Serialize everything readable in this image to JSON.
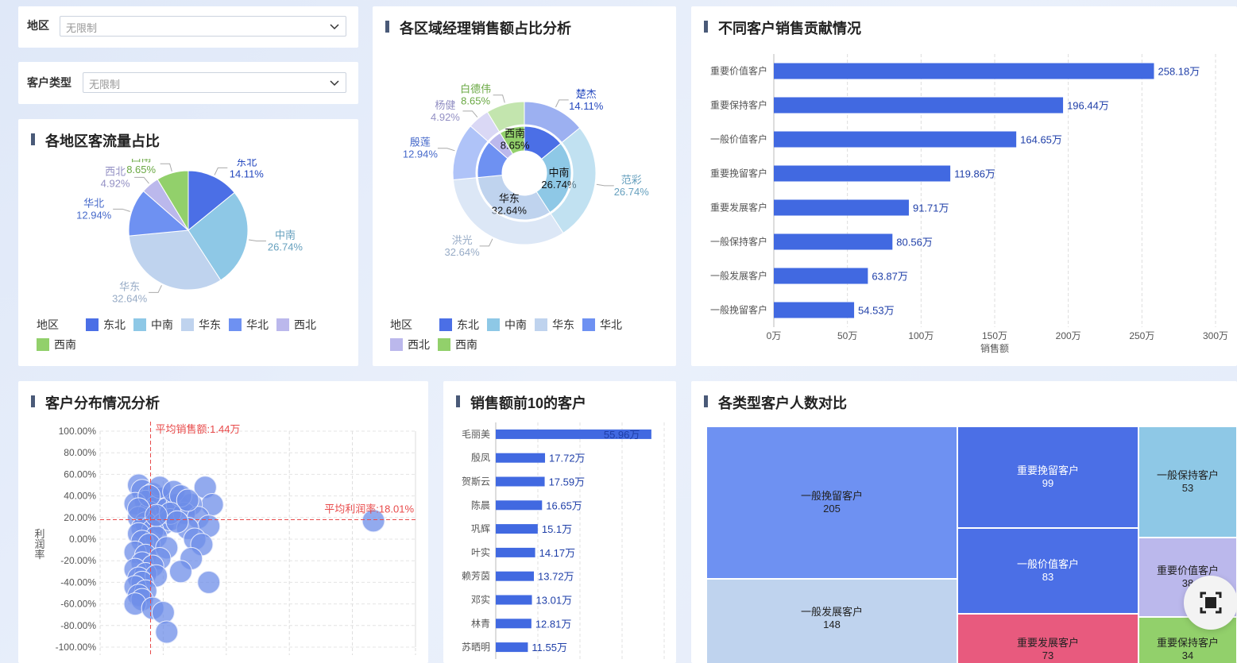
{
  "filters": {
    "region": {
      "label": "地区",
      "value": "无限制"
    },
    "customer_type": {
      "label": "客户类型",
      "value": "无限制"
    }
  },
  "colors": {
    "东北": "#4b6fe6",
    "中南": "#8ec8e6",
    "华东": "#bfd3ee",
    "华北": "#6e91f2",
    "西北": "#bbb8ec",
    "西南": "#92d06b",
    "bar": "#4169e1",
    "ref_line": "#e84a4a",
    "scatter": "#6d8de8",
    "重要发展客户": "#e85a7e",
    "重要保持客户": "#92d06b"
  },
  "region_pie": {
    "title": "各地区客流量占比",
    "legend_title": "地区",
    "legend": [
      "东北",
      "中南",
      "华东",
      "华北",
      "西北",
      "西南"
    ]
  },
  "manager_pie": {
    "title": "各区域经理销售额占比分析",
    "legend_title": "地区",
    "legend": [
      "东北",
      "中南",
      "华东",
      "华北",
      "西北",
      "西南"
    ]
  },
  "customer_bar": {
    "title": "不同客户销售贡献情况",
    "axis_label": "销售额"
  },
  "scatter": {
    "title": "客户分布情况分析",
    "ylabel": "利润率",
    "avg_sales_label": "平均销售额:1.44万",
    "avg_profit_label": "平均利润率:18.01%"
  },
  "top10": {
    "title": "销售额前10的客户"
  },
  "treemap": {
    "title": "各类型客户人数对比",
    "cells": [
      {
        "name": "一般挽留客户",
        "value": "205"
      },
      {
        "name": "一般发展客户",
        "value": "148"
      },
      {
        "name": "重要挽留客户",
        "value": "99"
      },
      {
        "name": "一般价值客户",
        "value": "83"
      },
      {
        "name": "重要发展客户",
        "value": "73"
      },
      {
        "name": "一般保持客户",
        "value": "53"
      },
      {
        "name": "重要价值客户",
        "value": "38"
      },
      {
        "name": "重要保持客户",
        "value": "34"
      }
    ]
  },
  "chart_data": [
    {
      "type": "pie",
      "title": "各地区客流量占比",
      "slices": [
        {
          "label": "东北",
          "value": 14.11,
          "text": "14.11%"
        },
        {
          "label": "中南",
          "value": 26.74,
          "text": "26.74%"
        },
        {
          "label": "华东",
          "value": 32.64,
          "text": "32.64%"
        },
        {
          "label": "华北",
          "value": 12.94,
          "text": "12.94%"
        },
        {
          "label": "西北",
          "value": 4.92,
          "text": "4.92%"
        },
        {
          "label": "西南",
          "value": 8.65,
          "text": "8.65%"
        }
      ]
    },
    {
      "type": "pie",
      "title": "各区域经理销售额占比分析",
      "inner": [
        {
          "label": "东北",
          "value": 14.11
        },
        {
          "label": "中南",
          "value": 26.74,
          "text": "26.74%"
        },
        {
          "label": "华东",
          "value": 32.64,
          "text": "32.64%"
        },
        {
          "label": "华北",
          "value": 12.94
        },
        {
          "label": "西北",
          "value": 4.92
        },
        {
          "label": "西南",
          "value": 8.65,
          "text": "8.65%"
        }
      ],
      "outer": [
        {
          "label": "楚杰",
          "region": "东北",
          "value": 14.11,
          "text": "14.11%"
        },
        {
          "label": "范彩",
          "region": "中南",
          "value": 26.74,
          "text": "26.74%"
        },
        {
          "label": "洪光",
          "region": "华东",
          "value": 32.64,
          "text": "32.64%"
        },
        {
          "label": "殷莲",
          "region": "华北",
          "value": 12.94,
          "text": "12.94%"
        },
        {
          "label": "杨健",
          "region": "西北",
          "value": 4.92,
          "text": "4.92%"
        },
        {
          "label": "白德伟",
          "region": "西南",
          "value": 8.65,
          "text": "8.65%"
        }
      ]
    },
    {
      "type": "bar",
      "title": "不同客户销售贡献情况",
      "orientation": "horizontal",
      "categories": [
        "重要价值客户",
        "重要保持客户",
        "一般价值客户",
        "重要挽留客户",
        "重要发展客户",
        "一般保持客户",
        "一般发展客户",
        "一般挽留客户"
      ],
      "values": [
        258.18,
        196.44,
        164.65,
        119.86,
        91.71,
        80.56,
        63.87,
        54.53
      ],
      "value_labels": [
        "258.18万",
        "196.44万",
        "164.65万",
        "119.86万",
        "91.71万",
        "80.56万",
        "63.87万",
        "54.53万"
      ],
      "xlabel": "销售额",
      "xticks": [
        "0万",
        "50万",
        "100万",
        "150万",
        "200万",
        "250万",
        "300万"
      ],
      "xlim": [
        0,
        300
      ],
      "grid": true
    },
    {
      "type": "scatter",
      "title": "客户分布情况分析",
      "ylabel": "利润率",
      "yticks": [
        "100.00%",
        "80.00%",
        "60.00%",
        "40.00%",
        "20.00%",
        "0.00%",
        "-20.00%",
        "-40.00%",
        "-60.00%",
        "-80.00%",
        "-100.00%"
      ],
      "ylim": [
        -100,
        100
      ],
      "xlim": [
        0,
        9
      ],
      "avg_x": 1.44,
      "avg_y": 18.01,
      "points": [
        [
          1.1,
          50
        ],
        [
          1.2,
          45
        ],
        [
          1.5,
          42
        ],
        [
          1.7,
          38
        ],
        [
          1.3,
          35
        ],
        [
          1.0,
          33
        ],
        [
          1.6,
          30
        ],
        [
          1.9,
          28
        ],
        [
          2.2,
          32
        ],
        [
          1.4,
          25
        ],
        [
          1.1,
          20
        ],
        [
          1.3,
          15
        ],
        [
          1.8,
          14
        ],
        [
          2.0,
          18
        ],
        [
          1.2,
          10
        ],
        [
          1.5,
          8
        ],
        [
          1.1,
          5
        ],
        [
          1.6,
          2
        ],
        [
          1.2,
          -2
        ],
        [
          1.4,
          -5
        ],
        [
          1.9,
          -8
        ],
        [
          1.0,
          -12
        ],
        [
          1.3,
          -15
        ],
        [
          1.7,
          -18
        ],
        [
          1.2,
          -22
        ],
        [
          1.5,
          -25
        ],
        [
          1.0,
          -28
        ],
        [
          1.3,
          -32
        ],
        [
          1.1,
          -36
        ],
        [
          1.6,
          -34
        ],
        [
          1.2,
          -40
        ],
        [
          1.0,
          -44
        ],
        [
          1.3,
          -48
        ],
        [
          1.1,
          -52
        ],
        [
          1.2,
          -56
        ],
        [
          1.0,
          -60
        ],
        [
          1.5,
          -64
        ],
        [
          1.8,
          -68
        ],
        [
          1.9,
          -86
        ],
        [
          3.0,
          48
        ],
        [
          3.2,
          32
        ],
        [
          2.6,
          32
        ],
        [
          2.4,
          24
        ],
        [
          2.8,
          20
        ],
        [
          3.1,
          12
        ],
        [
          2.5,
          10
        ],
        [
          2.7,
          0
        ],
        [
          2.9,
          -5
        ],
        [
          2.6,
          -18
        ],
        [
          2.3,
          -30
        ],
        [
          3.1,
          -40
        ],
        [
          1.7,
          48
        ],
        [
          2.1,
          44
        ],
        [
          2.3,
          40
        ],
        [
          1.4,
          40
        ],
        [
          2.5,
          36
        ],
        [
          2.0,
          24
        ],
        [
          2.2,
          16
        ],
        [
          1.1,
          28
        ],
        [
          1.6,
          22
        ],
        [
          7.8,
          17
        ]
      ]
    },
    {
      "type": "bar",
      "title": "销售额前10的客户",
      "orientation": "horizontal",
      "categories": [
        "毛丽美",
        "殷凤",
        "贺斯云",
        "陈晨",
        "巩辉",
        "叶实",
        "赖芳茵",
        "邓实",
        "林青",
        "苏晒明"
      ],
      "values": [
        55.96,
        17.72,
        17.59,
        16.65,
        15.1,
        14.17,
        13.72,
        13.01,
        12.81,
        11.55
      ],
      "value_labels": [
        "55.96万",
        "17.72万",
        "17.59万",
        "16.65万",
        "15.1万",
        "14.17万",
        "13.72万",
        "13.01万",
        "12.81万",
        "11.55万"
      ],
      "xlim": [
        0,
        56
      ]
    },
    {
      "type": "treemap",
      "title": "各类型客户人数对比",
      "categories": [
        "一般挽留客户",
        "一般发展客户",
        "重要挽留客户",
        "一般价值客户",
        "重要发展客户",
        "一般保持客户",
        "重要价值客户",
        "重要保持客户"
      ],
      "values": [
        205,
        148,
        99,
        83,
        73,
        53,
        38,
        34
      ]
    }
  ]
}
